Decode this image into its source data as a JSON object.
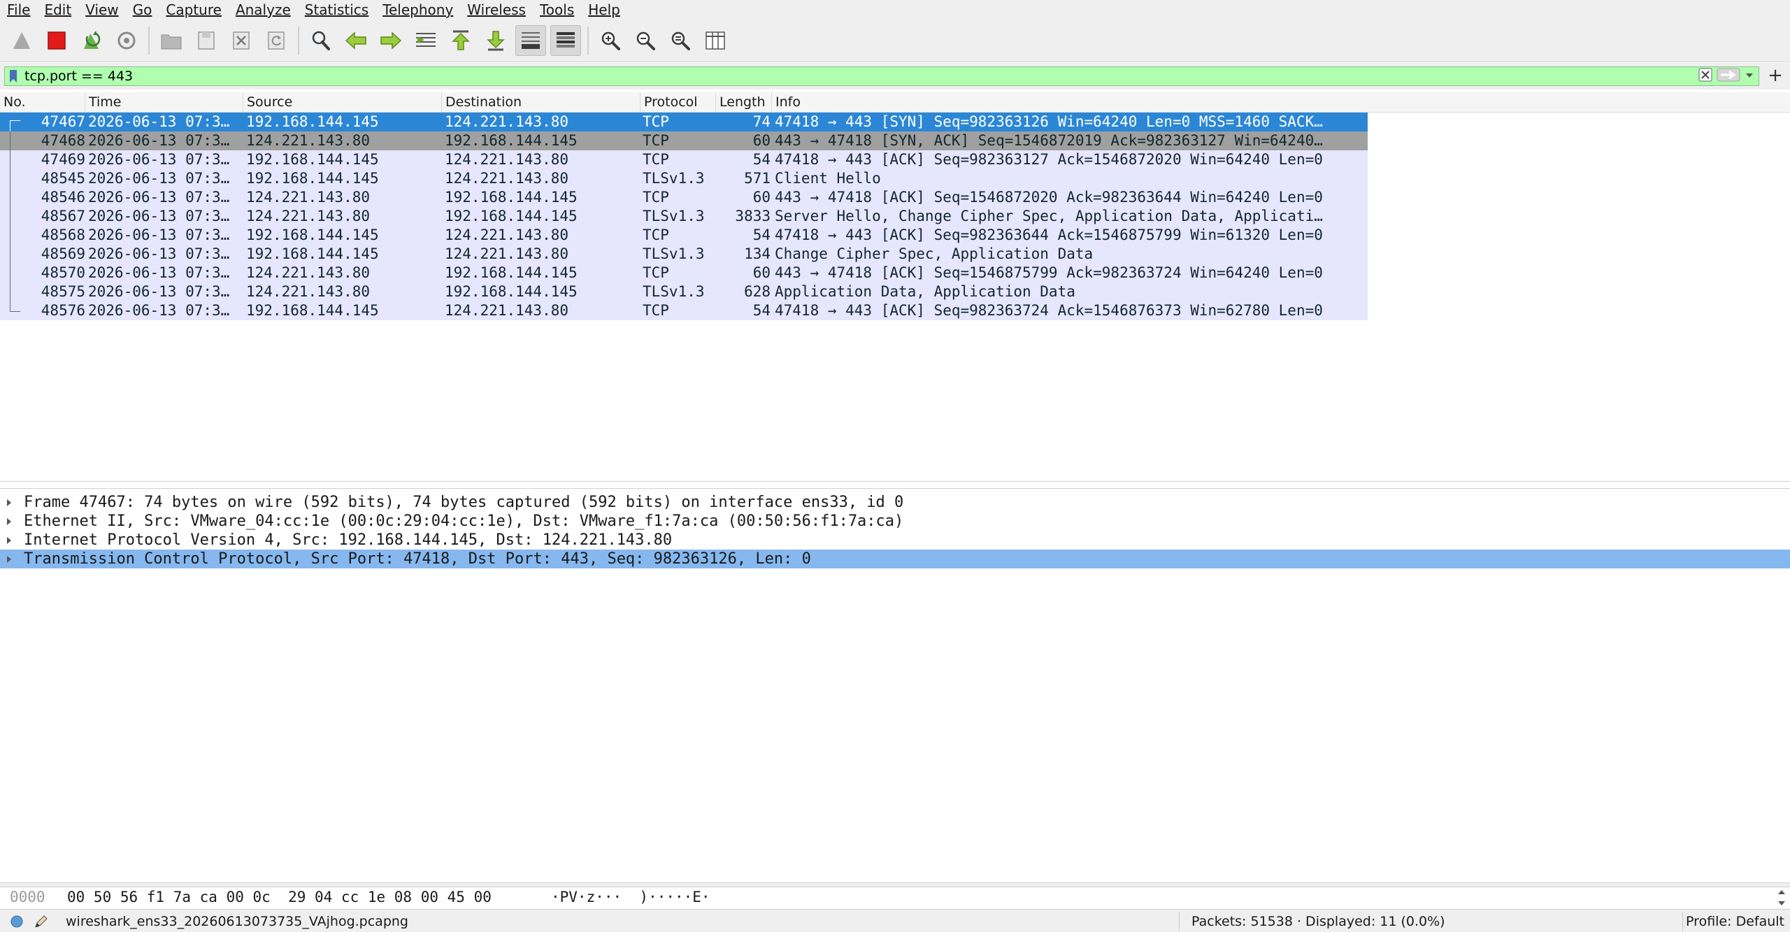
{
  "menu": [
    {
      "label": "File"
    },
    {
      "label": "Edit"
    },
    {
      "label": "View"
    },
    {
      "label": "Go"
    },
    {
      "label": "Capture"
    },
    {
      "label": "Analyze"
    },
    {
      "label": "Statistics"
    },
    {
      "label": "Telephony"
    },
    {
      "label": "Wireless"
    },
    {
      "label": "Tools"
    },
    {
      "label": "Help"
    }
  ],
  "toolbar": {
    "icons": [
      "shark-fin-start-icon",
      "stop-icon",
      "restart-icon",
      "capture-options-icon",
      "open-file-icon",
      "save-file-icon",
      "close-file-icon",
      "reload-icon",
      "find-packet-icon",
      "go-back-icon",
      "go-forward-icon",
      "go-to-packet-icon",
      "first-packet-icon",
      "last-packet-icon",
      "auto-scroll-icon",
      "colorize-icon",
      "zoom-in-icon",
      "zoom-out-icon",
      "normal-size-icon",
      "resize-columns-icon"
    ]
  },
  "filter": {
    "value": "tcp.port == 443",
    "background": "#afffaf"
  },
  "packet_list": {
    "columns": [
      "No.",
      "Time",
      "Source",
      "Destination",
      "Protocol",
      "Length",
      "Info"
    ],
    "rows": [
      {
        "no": "47467",
        "time": "2026-06-13 07:3…",
        "src": "192.168.144.145",
        "dst": "124.221.143.80",
        "proto": "TCP",
        "len": "74",
        "info": "47418 → 443 [SYN] Seq=982363126 Win=64240 Len=0 MSS=1460 SACK…",
        "state": "selected"
      },
      {
        "no": "47468",
        "time": "2026-06-13 07:3…",
        "src": "124.221.143.80",
        "dst": "192.168.144.145",
        "proto": "TCP",
        "len": "60",
        "info": "443 → 47418 [SYN, ACK] Seq=1546872019 Ack=982363127 Win=64240…",
        "state": "related"
      },
      {
        "no": "47469",
        "time": "2026-06-13 07:3…",
        "src": "192.168.144.145",
        "dst": "124.221.143.80",
        "proto": "TCP",
        "len": "54",
        "info": "47418 → 443 [ACK] Seq=982363127 Ack=1546872020 Win=64240 Len=0",
        "state": ""
      },
      {
        "no": "48545",
        "time": "2026-06-13 07:3…",
        "src": "192.168.144.145",
        "dst": "124.221.143.80",
        "proto": "TLSv1.3",
        "len": "571",
        "info": "Client Hello",
        "state": ""
      },
      {
        "no": "48546",
        "time": "2026-06-13 07:3…",
        "src": "124.221.143.80",
        "dst": "192.168.144.145",
        "proto": "TCP",
        "len": "60",
        "info": "443 → 47418 [ACK] Seq=1546872020 Ack=982363644 Win=64240 Len=0",
        "state": ""
      },
      {
        "no": "48567",
        "time": "2026-06-13 07:3…",
        "src": "124.221.143.80",
        "dst": "192.168.144.145",
        "proto": "TLSv1.3",
        "len": "3833",
        "info": "Server Hello, Change Cipher Spec, Application Data, Applicati…",
        "state": ""
      },
      {
        "no": "48568",
        "time": "2026-06-13 07:3…",
        "src": "192.168.144.145",
        "dst": "124.221.143.80",
        "proto": "TCP",
        "len": "54",
        "info": "47418 → 443 [ACK] Seq=982363644 Ack=1546875799 Win=61320 Len=0",
        "state": ""
      },
      {
        "no": "48569",
        "time": "2026-06-13 07:3…",
        "src": "192.168.144.145",
        "dst": "124.221.143.80",
        "proto": "TLSv1.3",
        "len": "134",
        "info": "Change Cipher Spec, Application Data",
        "state": ""
      },
      {
        "no": "48570",
        "time": "2026-06-13 07:3…",
        "src": "124.221.143.80",
        "dst": "192.168.144.145",
        "proto": "TCP",
        "len": "60",
        "info": "443 → 47418 [ACK] Seq=1546875799 Ack=982363724 Win=64240 Len=0",
        "state": ""
      },
      {
        "no": "48575",
        "time": "2026-06-13 07:3…",
        "src": "124.221.143.80",
        "dst": "192.168.144.145",
        "proto": "TLSv1.3",
        "len": "628",
        "info": "Application Data, Application Data",
        "state": ""
      },
      {
        "no": "48576",
        "time": "2026-06-13 07:3…",
        "src": "192.168.144.145",
        "dst": "124.221.143.80",
        "proto": "TCP",
        "len": "54",
        "info": "47418 → 443 [ACK] Seq=982363724 Ack=1546876373 Win=62780 Len=0",
        "state": ""
      }
    ],
    "row_color": "#e7e6ff",
    "selected_color": "#2b87d6"
  },
  "details": [
    {
      "text": "Frame 47467: 74 bytes on wire (592 bits), 74 bytes captured (592 bits) on interface ens33, id 0",
      "selected": false
    },
    {
      "text": "Ethernet II, Src: VMware_04:cc:1e (00:0c:29:04:cc:1e), Dst: VMware_f1:7a:ca (00:50:56:f1:7a:ca)",
      "selected": false
    },
    {
      "text": "Internet Protocol Version 4, Src: 192.168.144.145, Dst: 124.221.143.80",
      "selected": false
    },
    {
      "text": "Transmission Control Protocol, Src Port: 47418, Dst Port: 443, Seq: 982363126, Len: 0",
      "selected": true
    }
  ],
  "bytes": {
    "offset": "0000",
    "hex": "00 50 56 f1 7a ca 00 0c  29 04 cc 1e 08 00 45 00",
    "ascii": "·PV·z···  )·····E·"
  },
  "status": {
    "file": "wireshark_ens33_20260613073735_VAjhog.pcapng",
    "packets": "Packets: 51538 · Displayed: 11 (0.0%)",
    "profile": "Profile: Default"
  }
}
